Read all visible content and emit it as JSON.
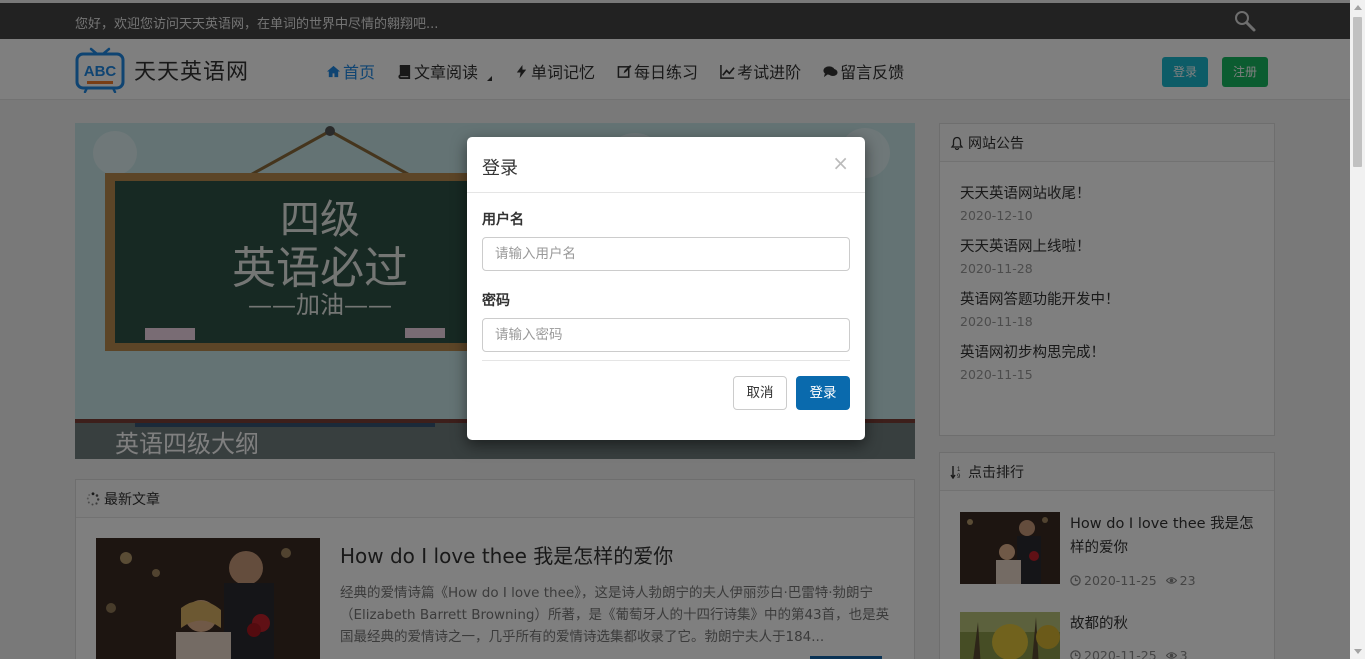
{
  "topbar": {
    "welcome": "您好，欢迎您访问天天英语网，在单词的世界中尽情的翱翔吧..."
  },
  "header": {
    "logo_badge": "ABC",
    "site_name": "天天英语网",
    "nav": [
      {
        "label": "首页",
        "icon": "home-icon",
        "active": true
      },
      {
        "label": "文章阅读",
        "icon": "book-icon",
        "dropdown": true
      },
      {
        "label": "单词记忆",
        "icon": "bolt-icon"
      },
      {
        "label": "每日练习",
        "icon": "edit-icon"
      },
      {
        "label": "考试进阶",
        "icon": "line-chart-icon"
      },
      {
        "label": "留言反馈",
        "icon": "comments-icon"
      }
    ],
    "login_label": "登录",
    "register_label": "注册"
  },
  "banner": {
    "board_line1": "四级",
    "board_line2": "英语必过",
    "board_line3": "——加油——",
    "caption": "英语四级大纲"
  },
  "latest": {
    "heading": "最新文章",
    "article": {
      "title": "How do I love thee 我是怎样的爱你",
      "summary": "经典的爱情诗篇《How do I love thee》，这是诗人勃朗宁的夫人伊丽莎白·巴雷特·勃朗宁（Elizabeth Barrett Browning）所著，是《葡萄牙人的十四行诗集》中的第43首，也是英国最经典的爱情诗之一，几乎所有的爱情诗选集都收录了它。勃朗宁夫人于184..."
    }
  },
  "notice": {
    "heading": "网站公告",
    "items": [
      {
        "title": "天天英语网站收尾！",
        "date": "2020-12-10"
      },
      {
        "title": "天天英语网上线啦！",
        "date": "2020-11-28"
      },
      {
        "title": "英语网答题功能开发中！",
        "date": "2020-11-18"
      },
      {
        "title": "英语网初步构思完成！",
        "date": "2020-11-15"
      }
    ]
  },
  "ranking": {
    "heading": "点击排行",
    "items": [
      {
        "title": "How do I love thee 我是怎样的爱你",
        "date": "2020-11-25",
        "views": "23"
      },
      {
        "title": "故都的秋",
        "date": "2020-11-25",
        "views": "3"
      }
    ]
  },
  "modal": {
    "title": "登录",
    "close": "×",
    "username_label": "用户名",
    "username_placeholder": "请输入用户名",
    "password_label": "密码",
    "password_placeholder": "请输入密码",
    "cancel_label": "取消",
    "submit_label": "登录"
  },
  "colors": {
    "topbar": "#444444",
    "nav_active": "#1e88e5",
    "login_top": "#1bb8ce",
    "register_top": "#16b860",
    "submit": "#0a6aad"
  }
}
